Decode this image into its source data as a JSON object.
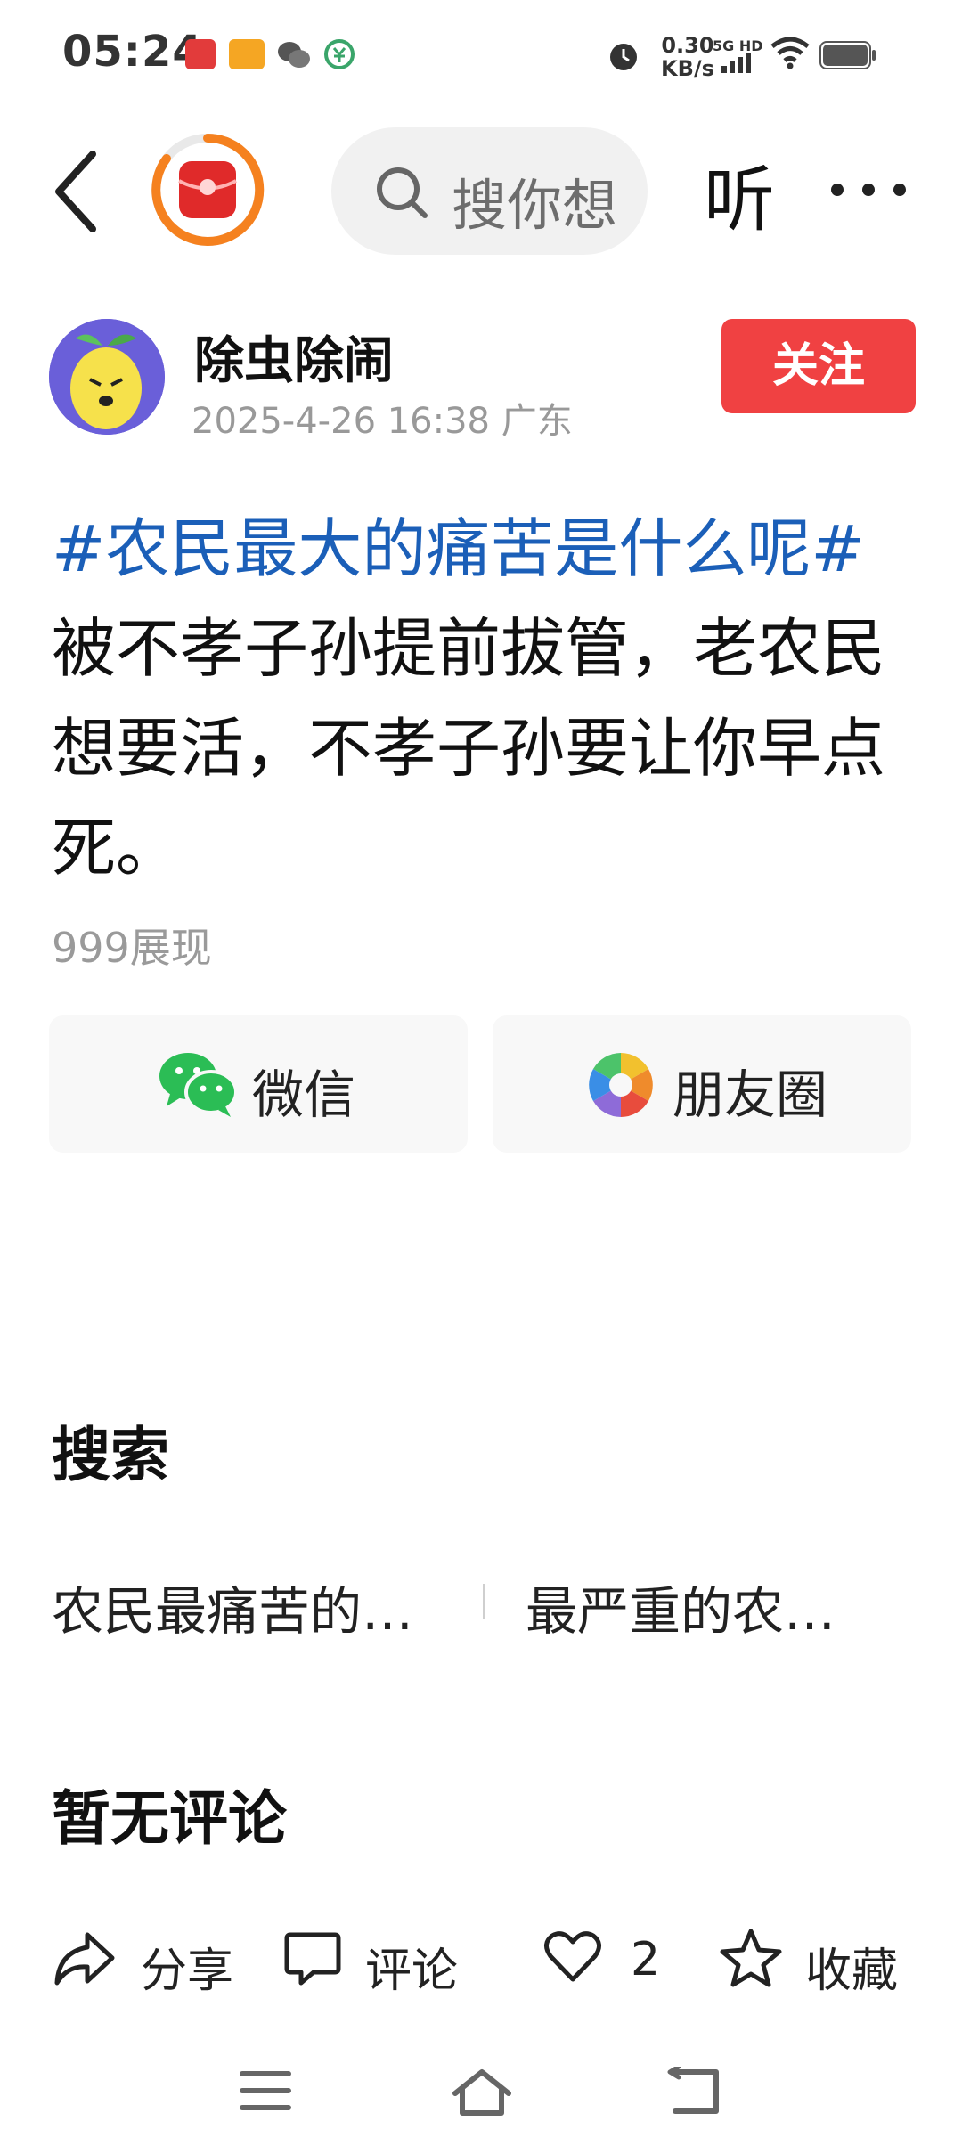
{
  "status_bar": {
    "time": "05:24",
    "net_speed_value": "0.30",
    "net_speed_unit": "KB/s",
    "net_type": "5G HD",
    "icons": [
      "toutiao-icon",
      "video-app-icon",
      "wechat-icon",
      "payment-icon",
      "alarm-icon",
      "signal-icon",
      "wifi-icon",
      "battery-icon"
    ]
  },
  "nav": {
    "search_placeholder": "搜你想",
    "listen_label": "听"
  },
  "author": {
    "name": "除虫除闹",
    "meta": "2025-4-26 16:38 广东",
    "follow_label": "关注"
  },
  "post": {
    "hashtag": "#农民最大的痛苦是什么呢#",
    "body": "被不孝子孙提前拔管，老农民想要活，不孝子孙要让你早点死。",
    "views": "999展现"
  },
  "share": {
    "wechat_label": "微信",
    "moments_label": "朋友圈"
  },
  "search_section": {
    "title": "搜索",
    "items": [
      "农民最痛苦的…",
      "最严重的农…"
    ]
  },
  "comments": {
    "title": "暂无评论"
  },
  "bottom_bar": {
    "share_label": "分享",
    "comment_label": "评论",
    "like_count": "2",
    "favorite_label": "收藏"
  },
  "colors": {
    "accent_red": "#f04142",
    "hashtag_blue": "#1b5fb8"
  }
}
